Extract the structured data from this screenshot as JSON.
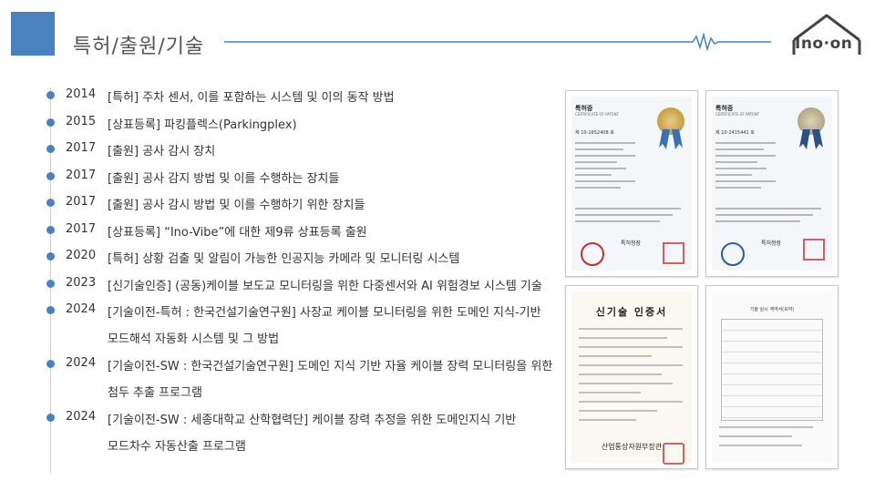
{
  "header": {
    "title": "특허/출원/기술",
    "logo_text": "Ino·on"
  },
  "timeline": [
    {
      "year": "2014",
      "text": "[특허] 주차 센서, 이를 포함하는 시스템 및 이의 동작 방법"
    },
    {
      "year": "2015",
      "text": "[상표등록] 파킹플렉스(Parkingplex)"
    },
    {
      "year": "2017",
      "text": "[출원] 공사 감시 장치"
    },
    {
      "year": "2017",
      "text": "[출원] 공사 감지 방법 및 이를 수행하는 장치들"
    },
    {
      "year": "2017",
      "text": "[출원] 공사 감시 방법 및 이를 수행하기 위한 장치들"
    },
    {
      "year": "2017",
      "text": "[상표등록] “Ino-Vibe”에 대한 제9류 상표등록 출원"
    },
    {
      "year": "2020",
      "text": "[특허] 상황 검출 및 알림이 가능한 인공지능 카메라 및 모니터링 시스템"
    },
    {
      "year": "2023",
      "text": "[신기술인증] (공동)케이블 보도교 모니터링을 위한 다중센서와 AI 위험경보 시스템 기술"
    },
    {
      "year": "2024",
      "text": "[기술이전-특허 : 한국건설기술연구원] 사장교 케이블 모니터링을 위한 도메인 지식-기반",
      "text2": "모드해석 자동화 시스템 및 그 방법"
    },
    {
      "year": "2024",
      "text": "[기술이전-SW : 한국건설기술연구원] 도메인 지식 기반 자율 케이블 장력 모니터링을 위한",
      "text2": "첨두 추출 프로그램"
    },
    {
      "year": "2024",
      "text": "[기술이전-SW : 세종대학교 산학협력단] 케이블 장력 추정을 위한 도메인지식 기반",
      "text2": "모드차수 자동산출 프로그램"
    }
  ],
  "certificates": {
    "patent1": {
      "heading": "특허증",
      "sub": "CERTIFICATE OF PATENT",
      "number": "제 10-1652408 호",
      "signer": "특허청장"
    },
    "patent2": {
      "heading": "특허증",
      "sub": "CERTIFICATE OF PATENT",
      "number": "제 10-2415441 호",
      "signer": "특허청장"
    },
    "newtech": {
      "title": "신기술 인증서",
      "issuer": "산업통상자원부장관"
    },
    "transfer": {
      "title": "기술 실시 계약서(요약)"
    }
  },
  "colors": {
    "accent": "#4a82c0",
    "seal_gold": "#c9a44a",
    "seal_silver": "#b8ad8c",
    "ribbon_blue": "#3b6fb6",
    "stamp_red": "#c0392b"
  },
  "icons": {
    "logo": "house-outline-icon",
    "pulse": "heartbeat-line-icon",
    "bullet": "dot-icon"
  }
}
